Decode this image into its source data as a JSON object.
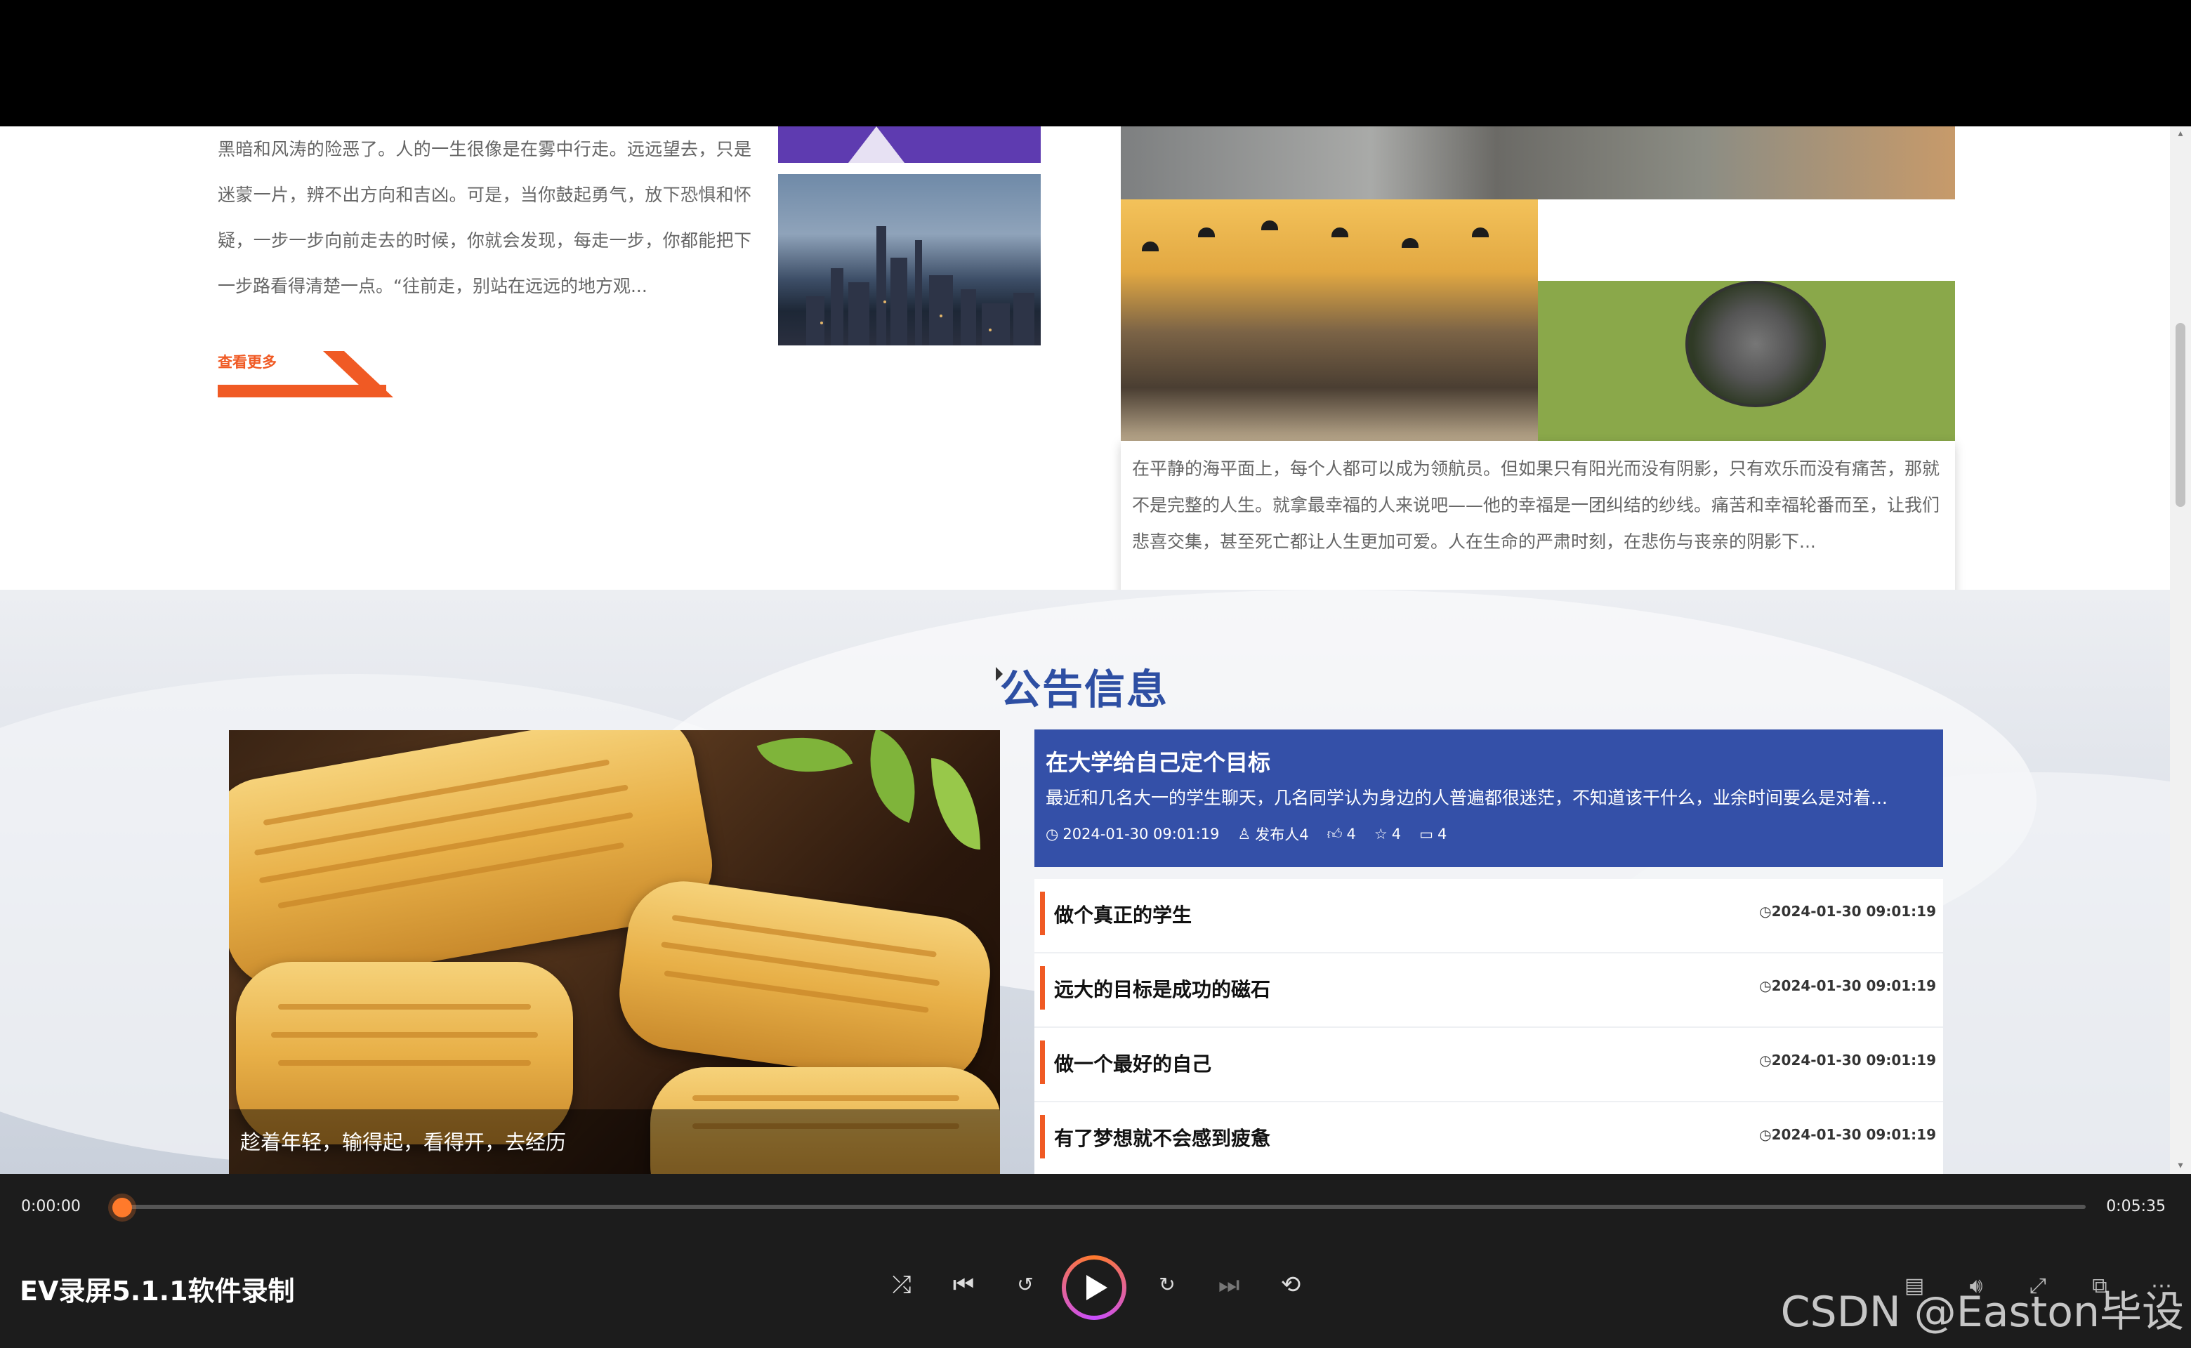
{
  "article": {
    "text": "黑暗和风涛的险恶了。人的一生很像是在雾中行走。远远望去，只是迷蒙一片，辨不出方向和吉凶。可是，当你鼓起勇气，放下恐惧和怀疑，一步一步向前走去的时候，你就会发现，每走一步，你都能把下一步路看得清楚一点。“往前走，别站在远远的地方观...",
    "more_label": "查看更多"
  },
  "card": {
    "text": "在平静的海平面上，每个人都可以成为领航员。但如果只有阳光而没有阴影，只有欢乐而没有痛苦，那就不是完整的人生。就拿最幸福的人来说吧——他的幸福是一团纠结的纱线。痛苦和幸福轮番而至，让我们悲喜交集，甚至死亡都让人生更加可爱。人在生命的严肃时刻，在悲伤与丧亲的阴影下..."
  },
  "notice": {
    "section_title": "公告信息",
    "image_caption": "趁着年轻，输得起，看得开，去经历",
    "featured": {
      "title": "在大学给自己定个目标",
      "summary": "最近和几名大一的学生聊天，几名同学认为身边的人普遍都很迷茫，不知道该干什么，业余时间要么是对着...",
      "time": "2024-01-30 09:01:19",
      "publisher": "发布人4",
      "likes": "4",
      "favorites": "4",
      "comments": "4"
    },
    "items": [
      {
        "title": "做个真正的学生",
        "time": "2024-01-30 09:01:19"
      },
      {
        "title": "远大的目标是成功的磁石",
        "time": "2024-01-30 09:01:19"
      },
      {
        "title": "做一个最好的自己",
        "time": "2024-01-30 09:01:19"
      },
      {
        "title": "有了梦想就不会感到疲惫",
        "time": "2024-01-30 09:01:19"
      }
    ]
  },
  "player": {
    "current_time": "0:00:00",
    "total_time": "0:05:35",
    "progress": 0.0,
    "title": "EV录屏5.1.1软件录制",
    "watermark": "CSDN @Easton毕设"
  },
  "colors": {
    "accent_orange": "#f05a24",
    "notice_blue": "#3450a8",
    "title_blue": "#2e4fa3",
    "player_bg": "#1c1c1c"
  }
}
